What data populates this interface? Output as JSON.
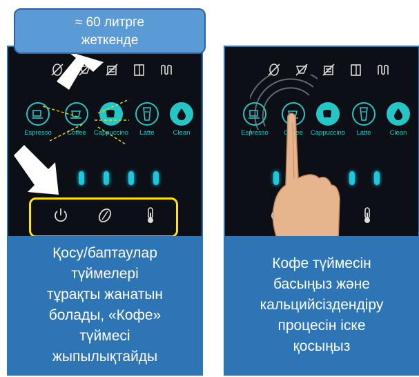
{
  "callout": {
    "text_line1": "≈ 60 литрге",
    "text_line2": "жеткенде"
  },
  "left_panel": {
    "caption": "Қосу/баптаулар\nтүймелері\nтұрақты жанатын\nболады, «Кофе»\nтүймесі\nжыпылықтайды",
    "drinks": [
      "Espresso",
      "Coffee",
      "Cappuccino",
      "Latte",
      "Clean"
    ]
  },
  "right_panel": {
    "caption": "Кофе түймесін\nбасыңыз және\nкальцийсіздендіру\nпроцесін іске\nқосыңыз",
    "drinks": [
      "Espresso",
      "Coffee",
      "Cappuccino",
      "Latte",
      "Clean"
    ]
  },
  "colors": {
    "accent": "#27c6c6",
    "panel_bg": "#0c0f16",
    "caption_bg": "#2e75b6",
    "highlight": "#ffe30a",
    "arrow": "#ffffff"
  },
  "icons": [
    "no-bean-icon",
    "no-grind-icon",
    "descale-icon",
    "door-icon",
    "drip-tray-icon",
    "power-icon",
    "bean-icon",
    "thermometer-icon"
  ]
}
